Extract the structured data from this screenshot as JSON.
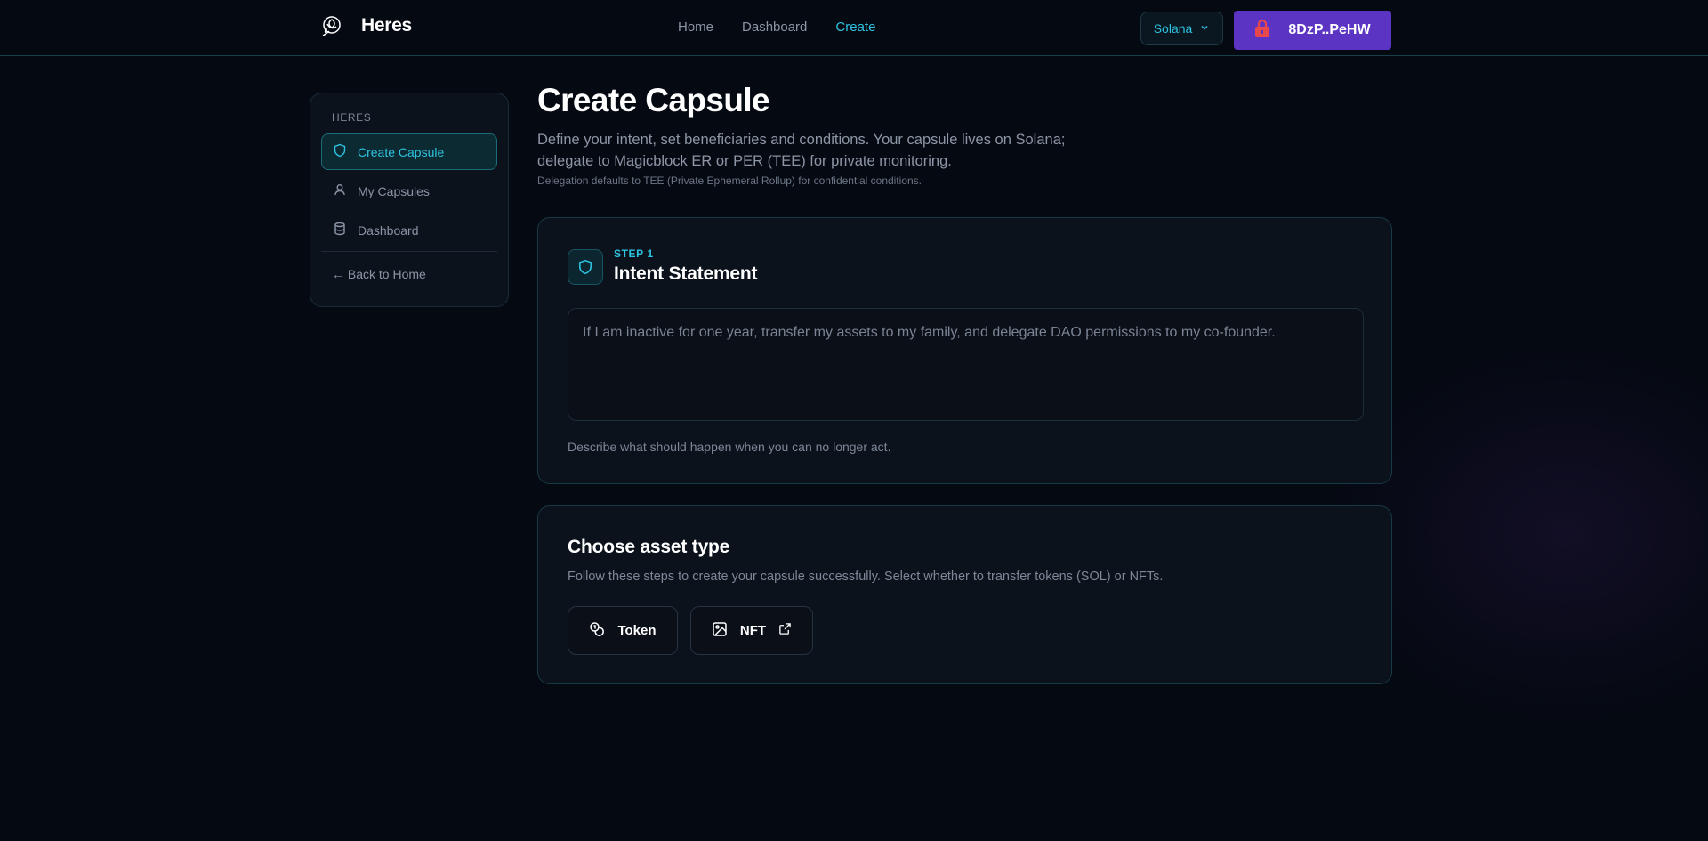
{
  "brand": {
    "name": "Heres"
  },
  "nav": {
    "items": [
      {
        "label": "Home",
        "active": false
      },
      {
        "label": "Dashboard",
        "active": false
      },
      {
        "label": "Create",
        "active": true
      }
    ]
  },
  "chain_select": {
    "value": "Solana"
  },
  "wallet": {
    "label": "8DzP..PeHW"
  },
  "sidebar": {
    "heading": "HERES",
    "items": [
      {
        "label": "Create Capsule",
        "icon": "shield-icon",
        "active": true
      },
      {
        "label": "My Capsules",
        "icon": "user-icon",
        "active": false
      },
      {
        "label": "Dashboard",
        "icon": "database-icon",
        "active": false
      }
    ],
    "back_label": "← Back to Home"
  },
  "page": {
    "title": "Create Capsule",
    "description": "Define your intent, set beneficiaries and conditions. Your capsule lives on Solana; delegate to Magicblock ER or PER (TEE) for private monitoring.",
    "note": "Delegation defaults to TEE (Private Ephemeral Rollup) for confidential conditions."
  },
  "intent": {
    "step_label": "STEP 1",
    "title": "Intent Statement",
    "placeholder": "If I am inactive for one year, transfer my assets to my family, and delegate DAO permissions to my co-founder.",
    "help": "Describe what should happen when you can no longer act."
  },
  "asset": {
    "title": "Choose asset type",
    "description": "Follow these steps to create your capsule successfully. Select whether to transfer tokens (SOL) or NFTs.",
    "token_label": "Token",
    "nft_label": "NFT"
  },
  "colors": {
    "accent": "#2ec3e0",
    "wallet_button": "#5b34c4",
    "background": "#050912",
    "card": "#0b121c"
  }
}
